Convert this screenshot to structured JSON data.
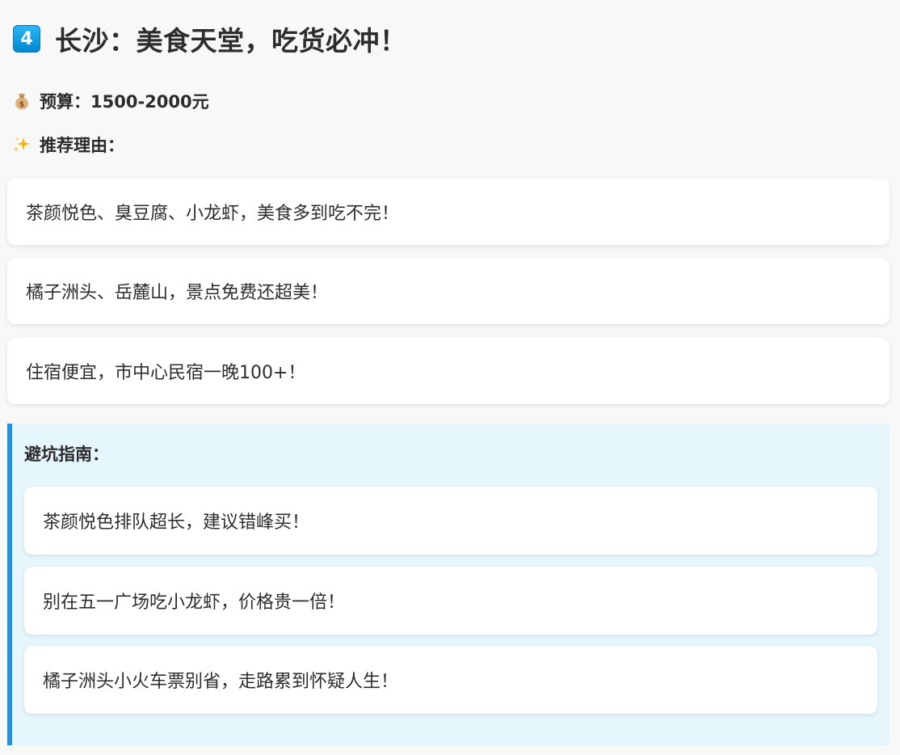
{
  "header": {
    "badge_number": "4",
    "title": "长沙：美食天堂，吃货必冲！"
  },
  "budget": {
    "icon": "money-bag-icon",
    "text": "预算：1500-2000元"
  },
  "reasons": {
    "icon": "sparkles-icon",
    "heading": "推荐理由：",
    "items": [
      "茶颜悦色、臭豆腐、小龙虾，美食多到吃不完！",
      "橘子洲头、岳麓山，景点免费还超美！",
      "住宿便宜，市中心民宿一晚100+！"
    ]
  },
  "guide": {
    "heading": "避坑指南：",
    "items": [
      "茶颜悦色排队超长，建议错峰买！",
      "别在五一广场吃小龙虾，价格贵一倍！",
      "橘子洲头小火车票别省，走路累到怀疑人生！"
    ]
  },
  "colors": {
    "accent": "#1e90e8",
    "guide_background": "#e6f6fd",
    "badge": "#0288d1"
  }
}
